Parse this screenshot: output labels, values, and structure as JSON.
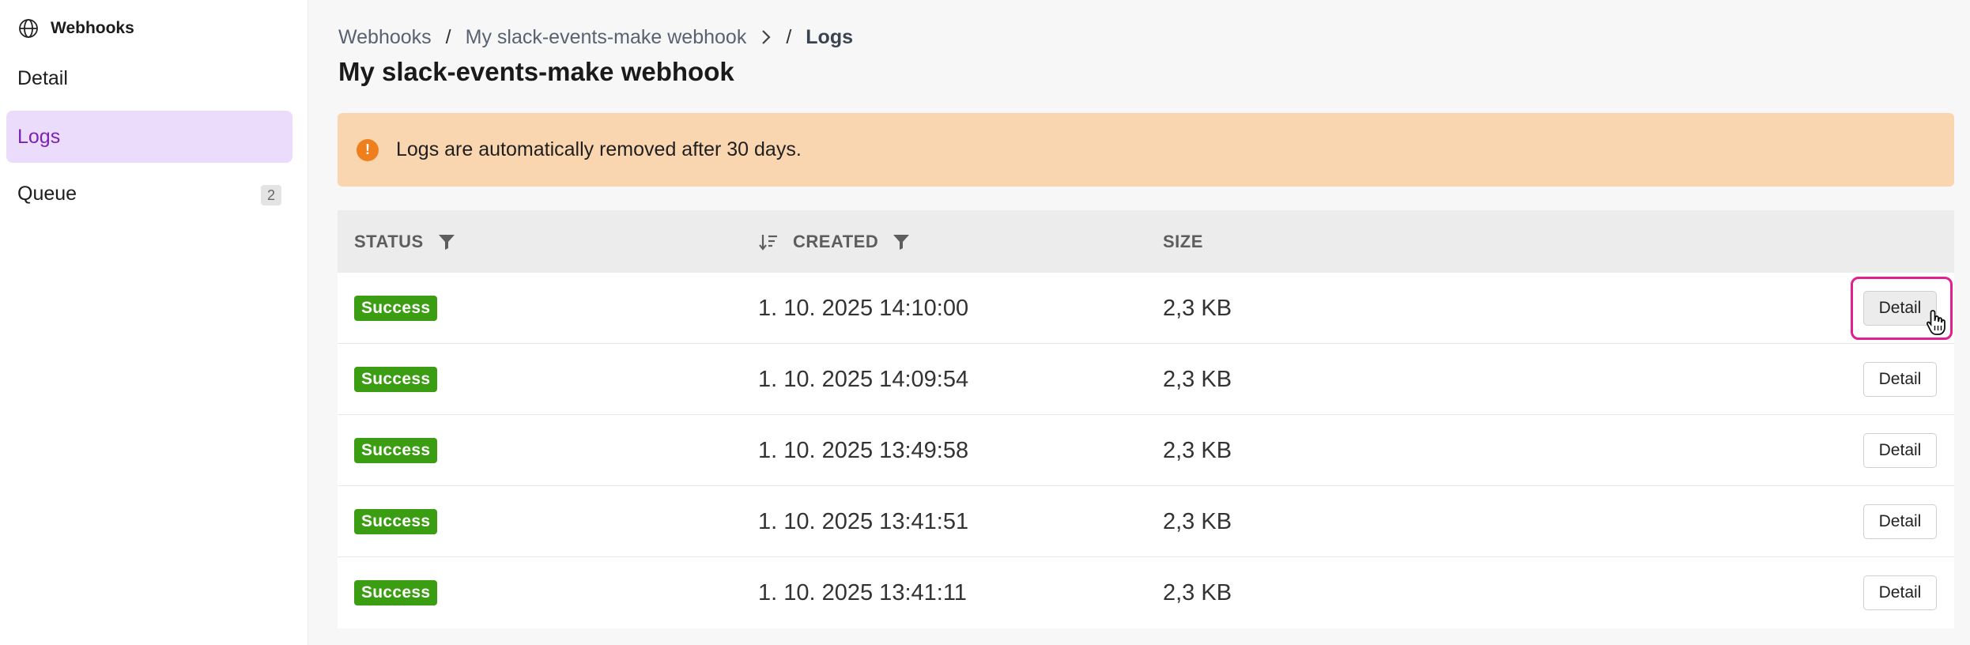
{
  "sidebar": {
    "header": {
      "icon": "globe-icon",
      "title": "Webhooks"
    },
    "items": [
      {
        "label": "Detail",
        "active": false
      },
      {
        "label": "Logs",
        "active": true
      },
      {
        "label": "Queue",
        "active": false,
        "badge": "2"
      }
    ]
  },
  "breadcrumb": {
    "items": [
      "Webhooks",
      "My slack-events-make webhook"
    ],
    "separator": "/",
    "current": "Logs"
  },
  "page": {
    "title": "My slack-events-make webhook"
  },
  "alert": {
    "icon": "warning-circle-icon",
    "message": "Logs are automatically removed after 30 days.",
    "color": "#fad6b0"
  },
  "table": {
    "columns": {
      "status": "STATUS",
      "created": "CREATED",
      "size": "SIZE"
    },
    "rows": [
      {
        "status": "Success",
        "created": "1. 10. 2025 14:10:00",
        "size": "2,3 KB",
        "action": "Detail"
      },
      {
        "status": "Success",
        "created": "1. 10. 2025 14:09:54",
        "size": "2,3 KB",
        "action": "Detail"
      },
      {
        "status": "Success",
        "created": "1. 10. 2025 13:49:58",
        "size": "2,3 KB",
        "action": "Detail"
      },
      {
        "status": "Success",
        "created": "1. 10. 2025 13:41:51",
        "size": "2,3 KB",
        "action": "Detail"
      },
      {
        "status": "Success",
        "created": "1. 10. 2025 13:41:11",
        "size": "2,3 KB",
        "action": "Detail"
      }
    ]
  },
  "colors": {
    "accent": "#7a23b6",
    "active_bg": "#ebdcfb",
    "success": "#3a9d12",
    "highlight": "#e0208e"
  }
}
